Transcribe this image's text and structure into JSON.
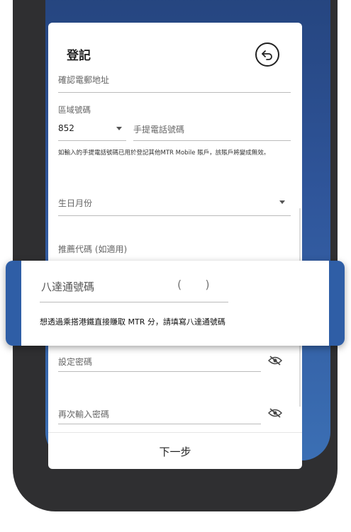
{
  "form": {
    "title": "登記",
    "confirm_email_placeholder": "確認電郵地址",
    "area_code_label": "區域號碼",
    "area_code_value": "852",
    "mobile_placeholder": "手提電話號碼",
    "notice": "如輸入的手提電話號碼已用於登記其他MTR Mobile 賬戶，該賬戶將變成無效。",
    "birth_month_placeholder": "生日月份",
    "referral_placeholder": "推薦代碼 (如適用)",
    "set_password_placeholder": "設定密碼",
    "confirm_password_placeholder": "再次輸入密碼",
    "next_label": "下一步"
  },
  "octopus": {
    "placeholder": "八達通號碼",
    "paren": "( )",
    "hint": "想透過乘搭港鐵直接賺取 MTR 分，請填寫八達通號碼"
  },
  "icons": {
    "back": "back-arrow-icon",
    "dropdown": "chevron-down-icon",
    "password_visibility": "eye-off-icon"
  },
  "colors": {
    "accent": "#2f5ea6",
    "frame": "#2f2f31"
  }
}
